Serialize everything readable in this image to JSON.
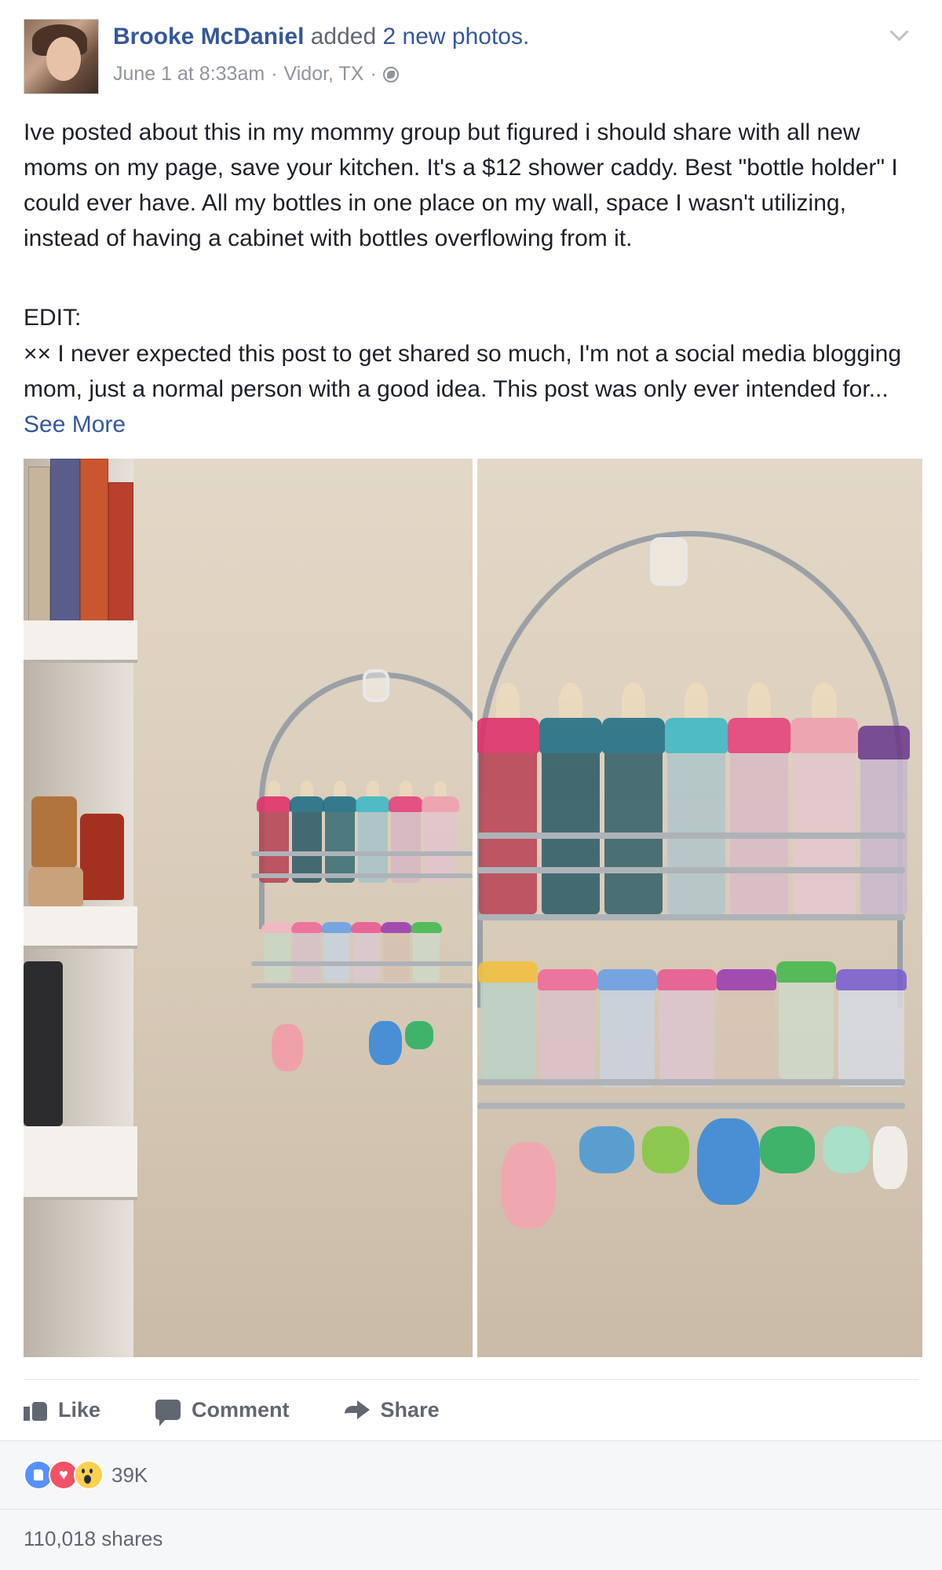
{
  "post": {
    "author": "Brooke McDaniel",
    "action_text": " added ",
    "photo_count_text": "2 new photos.",
    "date": "June 1 at 8:33am",
    "location": "Vidor, TX",
    "separator": "·",
    "privacy_icon": "globe-icon",
    "options_icon": "chevron-down-icon",
    "body": "Ive posted about this in my mommy group but figured i should share with all new moms on my page, save your kitchen. It's a $12 shower caddy. Best \"bottle holder\" I could ever have. All my bottles in one place on my wall, space I wasn't utilizing, instead of having a cabinet with bottles overflowing from it.",
    "edit_label": "EDIT:",
    "edit_body": "×× I never expected this post to get shared so much, I'm not a social media blogging mom, just a normal person with a good idea. This post was only ever intended for...",
    "see_more": " See More"
  },
  "actions": {
    "like": "Like",
    "comment": "Comment",
    "share": "Share"
  },
  "reactions": {
    "count": "39K",
    "types": [
      "like",
      "love",
      "wow"
    ]
  },
  "shares": "110,018 shares",
  "colors": {
    "link": "#365899",
    "meta": "#90949c",
    "action": "#616770",
    "footer_bg": "#f6f7f9"
  }
}
